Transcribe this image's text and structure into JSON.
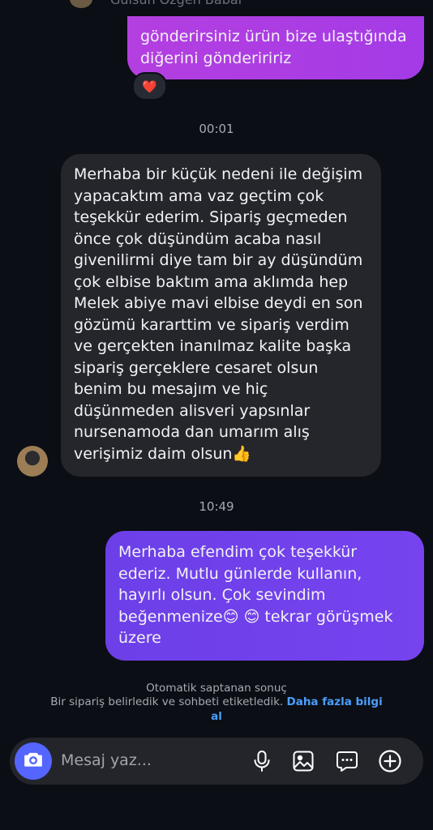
{
  "header": {
    "contact_name": "Gülsün Özgen Babal"
  },
  "messages": [
    {
      "direction": "outgoing",
      "text": "gönderirsiniz ürün bize ulaştığında diğerini gönderiririz",
      "reaction": "❤️"
    },
    {
      "type": "timestamp",
      "text": "00:01"
    },
    {
      "direction": "incoming",
      "text": "Merhaba bir küçük nedeni ile değişim yapacaktım ama vaz geçtim çok teşekkür ederim. Sipariş geçmeden önce çok düşündüm acaba nasıl givenilirmi diye tam bir ay düşündüm çok elbise baktım ama aklımda hep Melek abiye mavi elbise deydi en son gözümü kararttim ve sipariş verdim ve gerçekten inanılmaz kalite başka sipariş gerçeklere cesaret olsun benim bu mesajım ve hiç düşünmeden alisveri yapsınlar nursenamoda dan umarım alış verişimiz  daim olsun👍"
    },
    {
      "type": "timestamp",
      "text": "10:49"
    },
    {
      "direction": "outgoing",
      "text": "Merhaba efendim çok teşekkür ederiz. Mutlu günlerde kullanın, hayırlı olsun. Çok sevindim beğenmenize😊 😊  tekrar görüşmek üzere"
    }
  ],
  "auto_detect": {
    "title": "Otomatik saptanan sonuç",
    "body": "Bir sipariş belirledik ve sohbeti etiketledik.",
    "link": "Daha fazla bilgi al"
  },
  "composer": {
    "placeholder": "Mesaj yaz...",
    "icons": [
      "camera-icon",
      "microphone-icon",
      "gallery-icon",
      "sticker-chat-icon",
      "plus-icon"
    ]
  },
  "colors": {
    "background": "#0b0e14",
    "outgoing_pink": "#b43fe0",
    "outgoing_purple": "#6c3fe8",
    "incoming": "#25262b",
    "link": "#4a9eff",
    "camera_button": "#5565ff"
  }
}
